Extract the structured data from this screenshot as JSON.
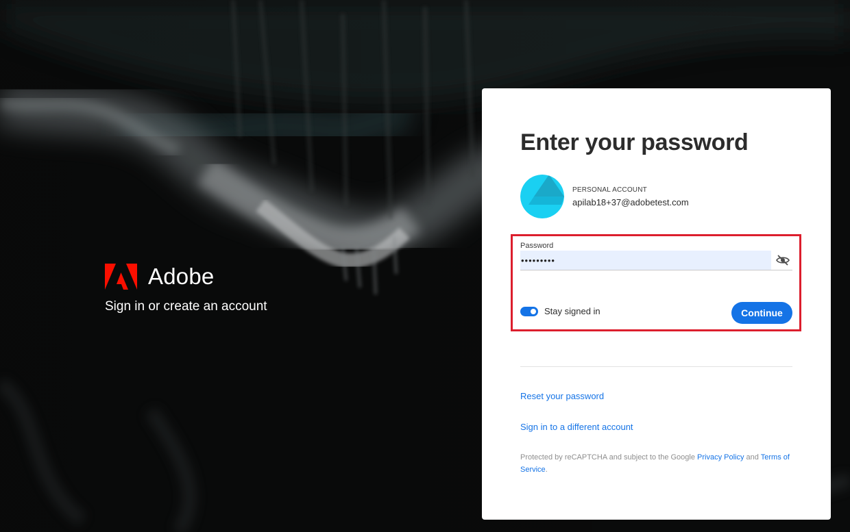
{
  "brand": {
    "name": "Adobe",
    "tagline": "Sign in or create an account",
    "logo_color": "#fa0f00"
  },
  "card": {
    "title": "Enter your password",
    "account": {
      "type": "PERSONAL ACCOUNT",
      "email": "apilab18+37@adobetest.com",
      "avatar_color": "#1ad0f2"
    },
    "password": {
      "label": "Password",
      "value": "•••••••••",
      "toggle_icon": "eye-slash-icon"
    },
    "stay_signed_in": {
      "label": "Stay signed in",
      "checked": true
    },
    "continue_label": "Continue",
    "links": {
      "reset_password": "Reset your password",
      "different_account": "Sign in to a different account"
    },
    "legal": {
      "prefix": "Protected by reCAPTCHA and subject to the Google ",
      "privacy_label": "Privacy Policy",
      "and_text": " and ",
      "terms_label": "Terms of Service",
      "suffix": "."
    }
  },
  "colors": {
    "accent": "#1473e6",
    "highlight": "#dc1e2d",
    "background": "#070808"
  }
}
